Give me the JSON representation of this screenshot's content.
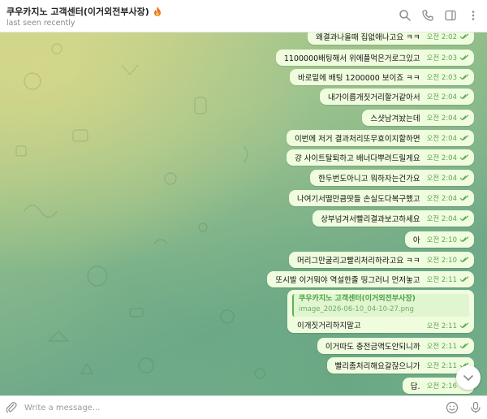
{
  "header": {
    "title": "쿠우카지노 고객센터(이거외전부사장)",
    "status": "last seen recently"
  },
  "messages": [
    {
      "text": "왜결과나올때 집없애나고요 ㅋㅋ",
      "time": "오전 2:02"
    },
    {
      "text": "1100000배팅해서 위에플먹은거로그있고",
      "time": "오전 2:03"
    },
    {
      "text": "바로밑에 배팅 1200000 보이죠 ㅋㅋ",
      "time": "오전 2:03"
    },
    {
      "text": "내가이릅개짓거리할거같아서",
      "time": "오전 2:04"
    },
    {
      "text": "스샷남겨놨는데",
      "time": "오전 2:04"
    },
    {
      "text": "이번에 저거 결과처리또무효이지할하면",
      "time": "오전 2:04"
    },
    {
      "text": "걍 사이트탈퇴하고 배너다뿌려드릴게요",
      "time": "오전 2:04"
    },
    {
      "text": "한두번도아니고 뭐하자는건가요",
      "time": "오전 2:04"
    },
    {
      "text": "나여기서떨만큼땃들 손실도다복구했고",
      "time": "오전 2:04"
    },
    {
      "text": "상부넘겨서빨리결과보고하세요",
      "time": "오전 2:04"
    },
    {
      "text": "아",
      "time": "오전 2:10"
    },
    {
      "text": "머리그만굴리고빨리처리하라고요 ㅋㅋ",
      "time": "오전 2:10"
    },
    {
      "text": "또시발 이거뭐야 역설한줄 띵그러니 먼저놓고",
      "time": "오전 2:11"
    }
  ],
  "reply_message": {
    "quoted_name": "쿠우카지노 고객센터(이거외전부사장)",
    "quoted_file": "image_2026-06-10_04-10-27.png",
    "text": "이개짓거리하지말고",
    "time": "오전 2:11"
  },
  "messages_after": [
    {
      "text": "이거따도 충전금액도안되니까",
      "time": "오전 2:11"
    },
    {
      "text": "빨리좀처리해요갈잖으니가",
      "time": "오전 2:11"
    },
    {
      "text": "답.",
      "time": "오전 2:16"
    }
  ],
  "composer": {
    "placeholder": "Write a message..."
  },
  "colors": {
    "bubble": "#effdde",
    "time": "#5ea553",
    "accent": "#4ca246"
  }
}
